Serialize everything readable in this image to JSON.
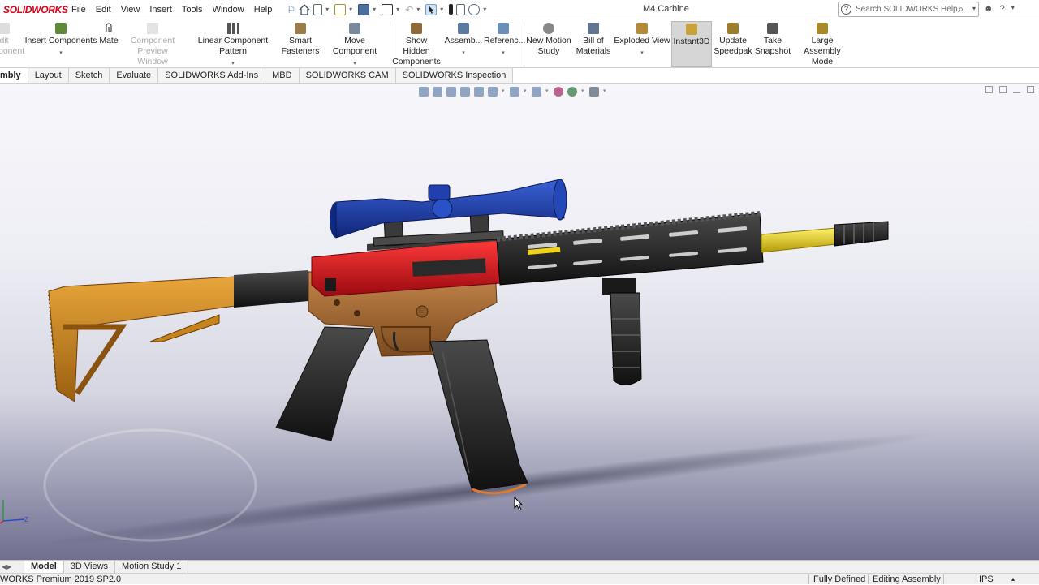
{
  "app": {
    "logo": "SOLIDWORKS",
    "menu": [
      "File",
      "Edit",
      "View",
      "Insert",
      "Tools",
      "Window",
      "Help"
    ],
    "document_title": "M4 Carbine",
    "search_placeholder": "Search SOLIDWORKS Help"
  },
  "ribbon": {
    "edit_component_1": "dit",
    "edit_component_2": "ponent",
    "insert_components": "Insert Components",
    "mate": "Mate",
    "component_preview_1": "Component",
    "component_preview_2": "Preview Window",
    "linear_pattern": "Linear Component Pattern",
    "smart_fasteners_1": "Smart",
    "smart_fasteners_2": "Fasteners",
    "move_component": "Move Component",
    "show_hidden_1": "Show Hidden",
    "show_hidden_2": "Components",
    "assembly": "Assemb...",
    "reference": "Referenc...",
    "new_motion_1": "New Motion",
    "new_motion_2": "Study",
    "bom_1": "Bill of",
    "bom_2": "Materials",
    "exploded_view": "Exploded View",
    "instant3d": "Instant3D",
    "update_speedpak_1": "Update",
    "update_speedpak_2": "Speedpak",
    "take_snapshot_1": "Take",
    "take_snapshot_2": "Snapshot",
    "large_assembly_1": "Large Assembly",
    "large_assembly_2": "Mode"
  },
  "tabs": [
    "mbly",
    "Layout",
    "Sketch",
    "Evaluate",
    "SOLIDWORKS Add-Ins",
    "MBD",
    "SOLIDWORKS CAM",
    "SOLIDWORKS Inspection"
  ],
  "bottom_tabs": [
    "Model",
    "3D Views",
    "Motion Study 1"
  ],
  "status": {
    "version": "WORKS Premium 2019 SP2.0",
    "defined": "Fully Defined",
    "mode": "Editing Assembly",
    "units": "IPS"
  },
  "colors": {
    "stock": "#c7841c",
    "receiver_upper": "#d3141e",
    "receiver_lower": "#a86b35",
    "scope": "#1c3c9c",
    "barrel_tip": "#f0d21a",
    "rail": "#2a2a2a",
    "background_top": "#f7f7fb",
    "background_bottom": "#6f6f8e"
  }
}
